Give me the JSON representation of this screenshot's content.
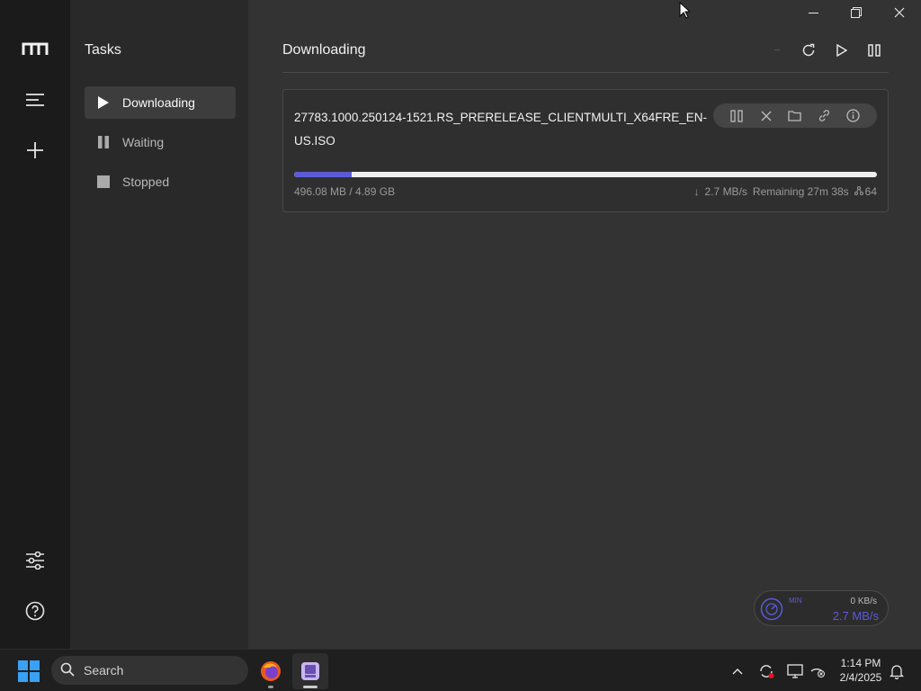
{
  "sidebar": {
    "title": "Tasks",
    "items": [
      {
        "label": "Downloading",
        "icon": "play-icon"
      },
      {
        "label": "Waiting",
        "icon": "pause-icon"
      },
      {
        "label": "Stopped",
        "icon": "stop-icon"
      }
    ]
  },
  "main": {
    "header": "Downloading"
  },
  "task": {
    "filename": "27783.1000.250124-1521.RS_PRERELEASE_CLIENTMULTI_X64FRE_EN-US.ISO",
    "progress_fraction": 0.099,
    "size_text": "496.08 MB / 4.89 GB",
    "speed": "2.7 MB/s",
    "remaining": "Remaining 27m 38s",
    "connections": "64"
  },
  "speedometer": {
    "mini": "MIN",
    "upload": "0 KB/s",
    "download": "2.7 MB/s"
  },
  "taskbar": {
    "search_placeholder": "Search",
    "time": "1:14 PM",
    "date": "2/4/2025"
  },
  "colors": {
    "accent": "#5b5bd6",
    "rail": "#1b1b1b",
    "subnav": "#292929",
    "main": "#333333"
  }
}
